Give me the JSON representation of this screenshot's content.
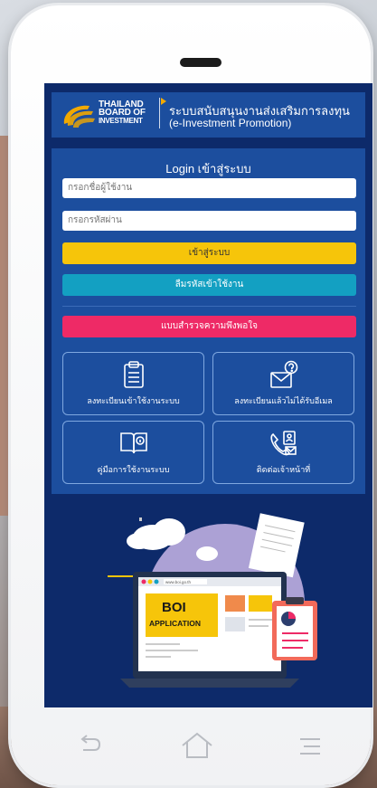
{
  "header": {
    "logo_lines": [
      "THAILAND",
      "BOARD OF",
      "INVESTMENT"
    ],
    "title_th": "ระบบสนับสนุนงานส่งเสริมการลงทุน",
    "title_en": "(e-Investment Promotion)"
  },
  "login": {
    "title": "Login เข้าสู่ระบบ",
    "username_placeholder": "กรอกชื่อผู้ใช้งาน",
    "password_placeholder": "กรอกรหัสผ่าน",
    "login_button": "เข้าสู่ระบบ",
    "forgot_button": "ลืมรหัสเข้าใช้งาน",
    "survey_button": "แบบสำรวจความพึงพอใจ"
  },
  "tiles": [
    {
      "label": "ลงทะเบียนเข้าใช้งานระบบ",
      "icon": "clipboard-list-icon"
    },
    {
      "label": "ลงทะเบียนแล้วไม่ได้รับอีเมล",
      "icon": "email-question-icon"
    },
    {
      "label": "คู่มือการใช้งานระบบ",
      "icon": "manual-book-icon"
    },
    {
      "label": "ติดต่อเจ้าหน้าที่",
      "icon": "phone-contact-icon"
    }
  ],
  "illustration": {
    "headline_1": "BOI",
    "headline_2": "APPLICATION",
    "url": "www.boi.go.th"
  },
  "colors": {
    "background_dark": "#0d2a6a",
    "panel_blue": "#1c4e9e",
    "login_yellow": "#f6c50a",
    "forgot_teal": "#13a0c2",
    "survey_pink": "#ee2a66"
  }
}
